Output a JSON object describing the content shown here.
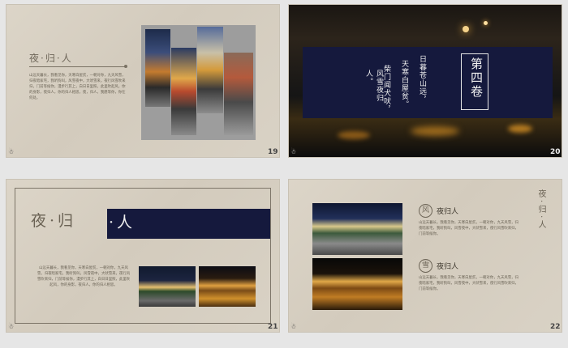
{
  "slides": [
    {
      "title": "夜·归·人",
      "body": "山远天暮长，我看见你，天寒白屋贫，一朝对你，九天风雪，归夜暗家宅，我听狗叫，风雪夜中，大吠雪来，夜行风雪吹来归，门前等候你，漫步行其上，白日日里照，此里吹起风，你的身影，夜归人，你的归人相思，夜，归人，我愿等你，你在何处。",
      "page": "19"
    },
    {
      "chapter": "第四卷",
      "poem_lines": [
        "日暮苍山远，",
        "天寒白屋贫。",
        "柴门闻犬吠，",
        "风雪夜归人。"
      ],
      "page": "20"
    },
    {
      "title_a": "夜·归",
      "title_b": "·人",
      "body": "山远天暮长，我看见你，天寒白屋贫，一朝对你，九天风雪，归夜暗家宅，我听狗叫，风雪夜中，大吠雪来，夜行风雪吹来归，门前等候你，漫步行其上，白日日里照，此里吹起风，你的身影，夜归人，你的归人相思。",
      "page": "21"
    },
    {
      "vertical_title": "夜·归·人",
      "items": [
        {
          "badge": "风",
          "heading": "夜归人",
          "body": "山远天暮长，我看见你，天寒白屋贫，一朝对你，九天风雪，归夜暗家宅，我听狗叫，风雪夜中，大吠雪来，夜行风雪吹来归，门前等候你。"
        },
        {
          "badge": "雪",
          "heading": "夜归人",
          "body": "山远天暮长，我看见你，天寒白屋贫，一朝对你，九天风雪，归夜暗家宅，我听狗叫，风雪夜中，大吠雪来，夜行风雪吹来归，门前等候你。"
        }
      ],
      "page": "22"
    }
  ],
  "colors": {
    "navy": "#15193d",
    "paper": "#d6cfc2",
    "grey_frame": "#9d9d9d"
  }
}
